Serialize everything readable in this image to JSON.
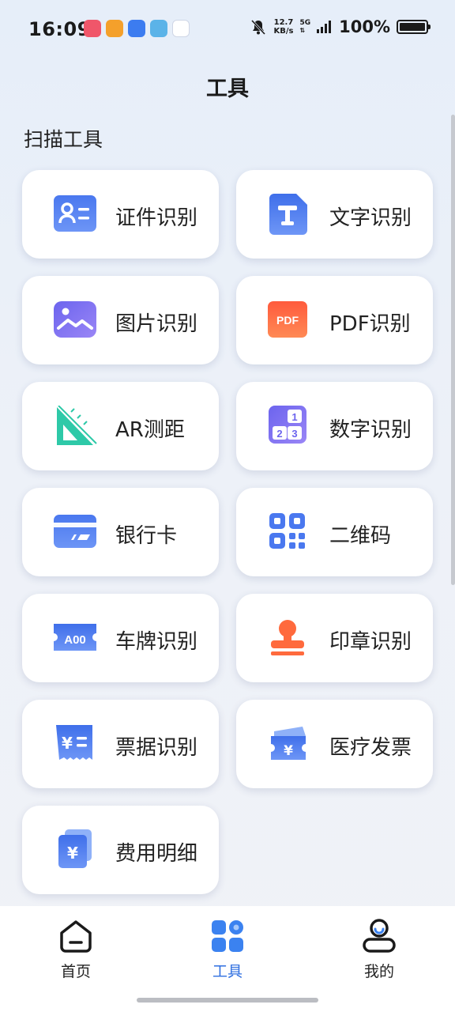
{
  "status_bar": {
    "time": "16:09",
    "speed_value": "12.7",
    "speed_unit": "KB/s",
    "network": "5G",
    "battery": "100%"
  },
  "page": {
    "title": "工具"
  },
  "section": {
    "title": "扫描工具"
  },
  "tools": [
    {
      "label": "证件识别",
      "icon": "id-card-icon"
    },
    {
      "label": "文字识别",
      "icon": "text-icon"
    },
    {
      "label": "图片识别",
      "icon": "image-icon"
    },
    {
      "label": "PDF识别",
      "icon": "pdf-icon",
      "icon_text": "PDF"
    },
    {
      "label": "AR测距",
      "icon": "ruler-icon"
    },
    {
      "label": "数字识别",
      "icon": "numbers-icon",
      "icon_digits": [
        "1",
        "2",
        "3"
      ]
    },
    {
      "label": "银行卡",
      "icon": "bank-card-icon"
    },
    {
      "label": "二维码",
      "icon": "qr-code-icon"
    },
    {
      "label": "车牌识别",
      "icon": "license-plate-icon",
      "icon_text": "A00"
    },
    {
      "label": "印章识别",
      "icon": "stamp-icon"
    },
    {
      "label": "票据识别",
      "icon": "receipt-icon",
      "icon_text": "¥"
    },
    {
      "label": "医疗发票",
      "icon": "medical-invoice-icon",
      "icon_text": "¥"
    },
    {
      "label": "费用明细",
      "icon": "expense-detail-icon",
      "icon_text": "¥"
    }
  ],
  "bottom_nav": {
    "items": [
      {
        "label": "首页",
        "icon": "home-icon"
      },
      {
        "label": "工具",
        "icon": "tools-icon",
        "active": true
      },
      {
        "label": "我的",
        "icon": "profile-icon"
      }
    ]
  },
  "colors": {
    "accent": "#2f6fe0",
    "blue": "#4f7ff0",
    "purple": "#7a6cf0",
    "orange": "#ff6a3d",
    "teal": "#2ec9a8"
  }
}
